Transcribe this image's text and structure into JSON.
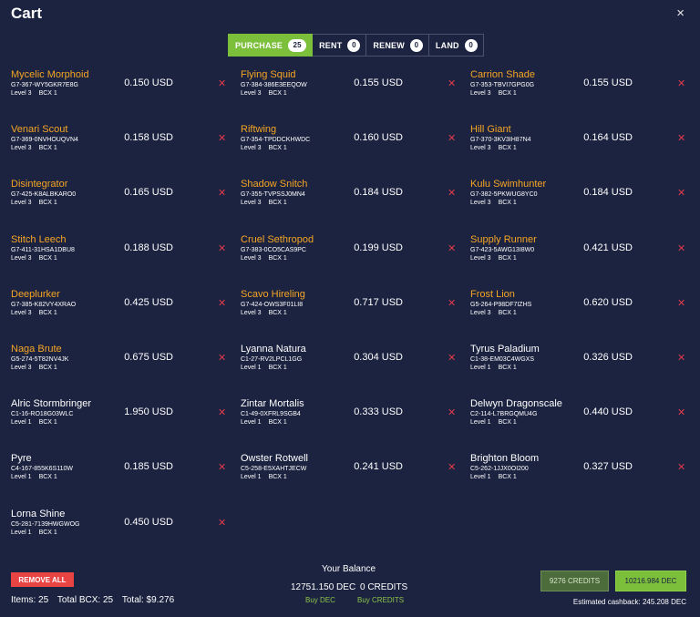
{
  "header": {
    "title": "Cart",
    "close": "×"
  },
  "tabs": [
    {
      "label": "PURCHASE",
      "count": "25",
      "active": true
    },
    {
      "label": "RENT",
      "count": "0"
    },
    {
      "label": "RENEW",
      "count": "0"
    },
    {
      "label": "LAND",
      "count": "0"
    }
  ],
  "items": [
    {
      "name": "Mycelic Morphoid",
      "uid": "G7-367-WY5GKR7E8G",
      "level": "Level 3",
      "bcx": "BCX 1",
      "price": "0.150 USD",
      "gold": true
    },
    {
      "name": "Flying Squid",
      "uid": "G7-384-386E3EEQOW",
      "level": "Level 3",
      "bcx": "BCX 1",
      "price": "0.155 USD",
      "gold": true
    },
    {
      "name": "Carrion Shade",
      "uid": "G7-353-TBVI7GPG0G",
      "level": "Level 3",
      "bcx": "BCX 1",
      "price": "0.155 USD",
      "gold": true
    },
    {
      "name": "Venari Scout",
      "uid": "G7-369-0NVHOUQVN4",
      "level": "Level 3",
      "bcx": "BCX 1",
      "price": "0.158 USD",
      "gold": true
    },
    {
      "name": "Riftwing",
      "uid": "G7-354-TPDDCKHWDC",
      "level": "Level 3",
      "bcx": "BCX 1",
      "price": "0.160 USD",
      "gold": true
    },
    {
      "name": "Hill Giant",
      "uid": "G7-370-3KV3IH87N4",
      "level": "Level 3",
      "bcx": "BCX 1",
      "price": "0.164 USD",
      "gold": true
    },
    {
      "name": "Disintegrator",
      "uid": "G7-425-K8ALBKARO0",
      "level": "Level 3",
      "bcx": "BCX 1",
      "price": "0.165 USD",
      "gold": true
    },
    {
      "name": "Shadow Snitch",
      "uid": "G7-355-TVPSSJ0MN4",
      "level": "Level 3",
      "bcx": "BCX 1",
      "price": "0.184 USD",
      "gold": true
    },
    {
      "name": "Kulu Swimhunter",
      "uid": "G7-382-5PKWUG8YC0",
      "level": "Level 3",
      "bcx": "BCX 1",
      "price": "0.184 USD",
      "gold": true
    },
    {
      "name": "Stitch Leech",
      "uid": "G7-411-31HSA1DBU8",
      "level": "Level 3",
      "bcx": "BCX 1",
      "price": "0.188 USD",
      "gold": true
    },
    {
      "name": "Cruel Sethropod",
      "uid": "G7-383-0CO5CAS9PC",
      "level": "Level 3",
      "bcx": "BCX 1",
      "price": "0.199 USD",
      "gold": true
    },
    {
      "name": "Supply Runner",
      "uid": "G7-423-5AWG13I8W0",
      "level": "Level 3",
      "bcx": "BCX 1",
      "price": "0.421 USD",
      "gold": true
    },
    {
      "name": "Deeplurker",
      "uid": "G7-385-K82VY4XRAO",
      "level": "Level 3",
      "bcx": "BCX 1",
      "price": "0.425 USD",
      "gold": true
    },
    {
      "name": "Scavo Hireling",
      "uid": "G7-424-OWS3F01LI8",
      "level": "Level 3",
      "bcx": "BCX 1",
      "price": "0.717 USD",
      "gold": true
    },
    {
      "name": "Frost Lion",
      "uid": "G5-264-P98DF7IZHS",
      "level": "Level 3",
      "bcx": "BCX 1",
      "price": "0.620 USD",
      "gold": true
    },
    {
      "name": "Naga Brute",
      "uid": "G5-274-5T82NV4JK",
      "level": "Level 3",
      "bcx": "BCX 1",
      "price": "0.675 USD",
      "gold": true
    },
    {
      "name": "Lyanna Natura",
      "uid": "C1-27-RV2LPCL1GG",
      "level": "Level 1",
      "bcx": "BCX 1",
      "price": "0.304 USD",
      "gold": false
    },
    {
      "name": "Tyrus Paladium",
      "uid": "C1-38-EM03C4WGXS",
      "level": "Level 1",
      "bcx": "BCX 1",
      "price": "0.326 USD",
      "gold": false
    },
    {
      "name": "Alric Stormbringer",
      "uid": "C1-16-RO18G03WLC",
      "level": "Level 1",
      "bcx": "BCX 1",
      "price": "1.950 USD",
      "gold": false
    },
    {
      "name": "Zintar Mortalis",
      "uid": "C1-49-0XFRL9SGB4",
      "level": "Level 1",
      "bcx": "BCX 1",
      "price": "0.333 USD",
      "gold": false
    },
    {
      "name": "Delwyn Dragonscale",
      "uid": "C2-114-L7BRGQMU4G",
      "level": "Level 1",
      "bcx": "BCX 1",
      "price": "0.440 USD",
      "gold": false
    },
    {
      "name": "Pyre",
      "uid": "C4-167-855K6S110W",
      "level": "Level 1",
      "bcx": "BCX 1",
      "price": "0.185 USD",
      "gold": false
    },
    {
      "name": "Owster Rotwell",
      "uid": "C5-258-E5XAHTJECW",
      "level": "Level 1",
      "bcx": "BCX 1",
      "price": "0.241 USD",
      "gold": false
    },
    {
      "name": "Brighton Bloom",
      "uid": "C5-262-1JJX0OI200",
      "level": "Level 1",
      "bcx": "BCX 1",
      "price": "0.327 USD",
      "gold": false
    },
    {
      "name": "Lorna Shine",
      "uid": "C5-281-7139HWGWOG",
      "level": "Level 1",
      "bcx": "BCX 1",
      "price": "0.450 USD",
      "gold": false
    }
  ],
  "footer": {
    "remove_all": "REMOVE ALL",
    "items": "Items: 25",
    "total_bcx": "Total BCX: 25",
    "total": "Total: $9.276",
    "balance_title": "Your Balance",
    "balance_dec": "12751.150 DEC",
    "balance_credits": "0 CREDITS",
    "buy_dec": "Buy DEC",
    "buy_credits": "Buy CREDITS",
    "pay_credits": "9276 CREDITS",
    "pay_dec": "10216.984 DEC",
    "cashback": "Estimated cashback: 245.208 DEC"
  },
  "colors": {
    "background": "#1c2340",
    "accent_green": "#7bbf3a",
    "gold": "#f5a524",
    "remove_red": "#e03a4a"
  }
}
